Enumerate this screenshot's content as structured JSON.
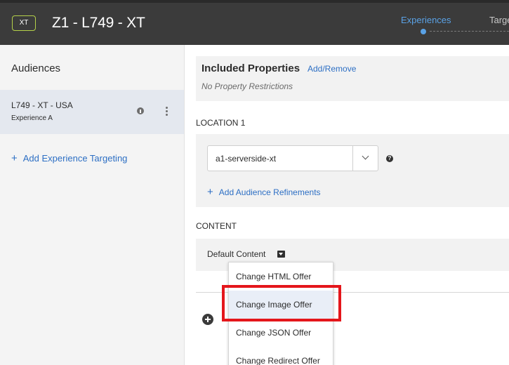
{
  "header": {
    "badge": "XT",
    "title": "Z1 - L749 - XT",
    "steps": [
      {
        "label": "Experiences",
        "active": true
      },
      {
        "label": "Targeting",
        "active": false
      }
    ]
  },
  "sidebar": {
    "title": "Audiences",
    "audiences": [
      {
        "name": "L749 - XT - USA",
        "experience": "Experience A"
      }
    ],
    "add_targeting_label": "Add Experience Targeting"
  },
  "properties": {
    "title": "Included Properties",
    "add_remove_label": "Add/Remove",
    "restriction_text": "No Property Restrictions"
  },
  "location": {
    "label": "LOCATION 1",
    "selected_value": "a1-serverside-xt",
    "add_refinements_label": "Add Audience Refinements"
  },
  "content": {
    "label": "CONTENT",
    "default_label": "Default Content",
    "menu_items": [
      "Change HTML Offer",
      "Change Image Offer",
      "Change JSON Offer",
      "Change Redirect Offer"
    ],
    "highlighted_item": "Change Image Offer"
  },
  "colors": {
    "header_bg": "#3b3b3b",
    "accent_blue": "#2d6fc4",
    "step_active": "#5aa2e6",
    "badge_border": "#b5d14a",
    "highlight_red": "#e4161b"
  }
}
